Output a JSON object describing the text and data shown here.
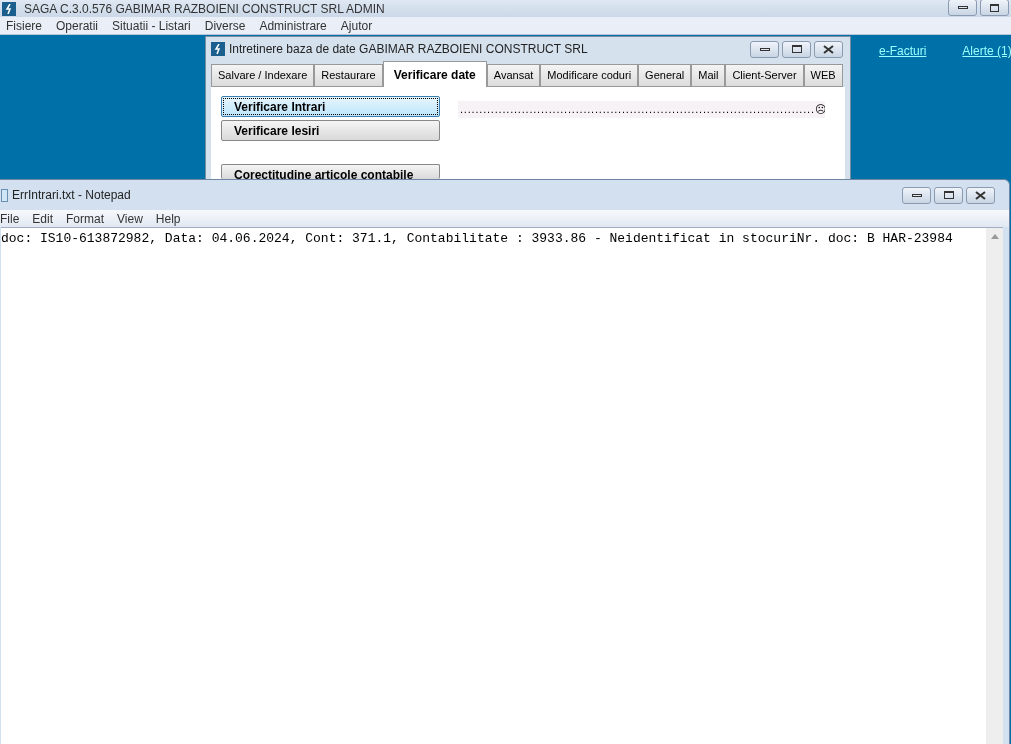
{
  "main_window": {
    "title": "SAGA C.3.0.576  GABIMAR RAZBOIENI CONSTRUCT SRL  ADMIN",
    "menu": [
      "Fisiere",
      "Operatii",
      "Situatii - Listari",
      "Diverse",
      "Administrare",
      "Ajutor"
    ],
    "links": [
      "e-Facturi",
      "Alerte (1)"
    ]
  },
  "maintenance_window": {
    "title": "Intretinere baza de date GABIMAR RAZBOIENI CONSTRUCT SRL",
    "tabs": [
      {
        "label": "Salvare / Indexare",
        "selected": false
      },
      {
        "label": "Restaurare",
        "selected": false
      },
      {
        "label": "Verificare date",
        "selected": true
      },
      {
        "label": "Avansat",
        "selected": false
      },
      {
        "label": "Modificare coduri",
        "selected": false
      },
      {
        "label": "General",
        "selected": false
      },
      {
        "label": "Mail",
        "selected": false
      },
      {
        "label": "Client-Server",
        "selected": false
      },
      {
        "label": "WEB",
        "selected": false
      }
    ],
    "buttons": [
      {
        "label": "Verificare Intrari",
        "focused": true
      },
      {
        "label": "Verificare Iesiri",
        "focused": false
      },
      {
        "label": "Corectitudine articole contabile",
        "focused": false
      }
    ],
    "progress": {
      "text": "............................................................................................☹"
    }
  },
  "notepad": {
    "title": "ErrIntrari.txt - Notepad",
    "menu": [
      "File",
      "Edit",
      "Format",
      "View",
      "Help"
    ],
    "content": "doc: IS10-613872982, Data: 04.06.2024, Cont: 371.1, Contabilitate : 3933.86 - Neidentificat in stocuriNr. doc: B HAR-23984"
  }
}
